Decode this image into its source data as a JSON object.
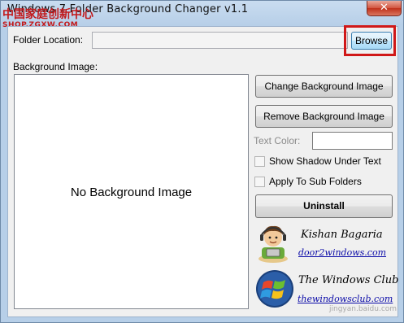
{
  "window": {
    "title": "Windows 7 Folder Background Changer v1.1",
    "close_glyph": "✕"
  },
  "watermark": {
    "main": "中国家庭创新中心",
    "sub": "SHOP.ZGXW.COM",
    "corner": "jingyan.baidu.com"
  },
  "folder": {
    "label": "Folder Location:",
    "value": "",
    "browse_label": "Browse"
  },
  "background": {
    "label": "Background Image:",
    "preview_text": "No Background Image"
  },
  "buttons": {
    "change": "Change Background Image",
    "remove": "Remove Background Image",
    "uninstall": "Uninstall"
  },
  "text_color": {
    "label": "Text Color:",
    "value": ""
  },
  "options": [
    {
      "label": "Show Shadow Under Text",
      "checked": false
    },
    {
      "label": "Apply To Sub Folders",
      "checked": false
    }
  ],
  "credits": [
    {
      "name": "Kishan Bagaria",
      "link": "door2windows.com",
      "icon": "cartoon-avatar-icon"
    },
    {
      "name": "The Windows Club",
      "link": "thewindowsclub.com",
      "icon": "windows-logo-icon"
    }
  ],
  "colors": {
    "highlight": "#d01818",
    "link": "#0a0aa8",
    "window_frame": "#b9d1ea",
    "dialog_bg": "#f0f0f0"
  }
}
